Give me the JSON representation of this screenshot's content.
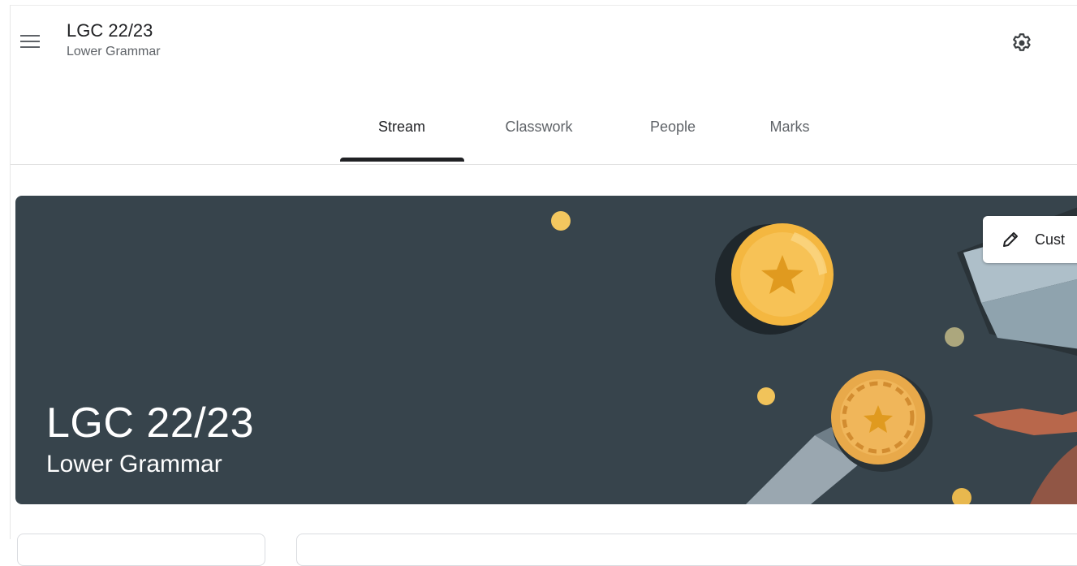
{
  "header": {
    "title": "LGC 22/23",
    "subtitle": "Lower Grammar"
  },
  "tabs": [
    {
      "label": "Stream",
      "active": true
    },
    {
      "label": "Classwork",
      "active": false
    },
    {
      "label": "People",
      "active": false
    },
    {
      "label": "Marks",
      "active": false
    }
  ],
  "banner": {
    "title": "LGC 22/23",
    "subtitle": "Lower Grammar",
    "customise_label": "Cust",
    "background_color": "#37444c"
  },
  "icons": {
    "menu": "hamburger-menu-icon",
    "settings": "gear-icon",
    "customise": "pencil-icon"
  }
}
